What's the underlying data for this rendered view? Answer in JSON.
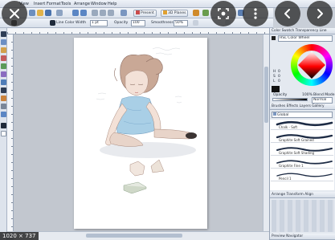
{
  "menu": [
    "View",
    "Insert",
    "Format",
    "Tools",
    "Arrange",
    "Window",
    "Help"
  ],
  "toolbar": {
    "present_label": "Present",
    "planes_label": "3D Planes"
  },
  "properties": {
    "line_color_label": "Line Color",
    "width_label": "Width",
    "width_value": "1 pt",
    "opacity_label": "Opacity",
    "opacity_value": "100",
    "smoothness_label": "Smoothness",
    "smoothness_value": "50%"
  },
  "color_panel": {
    "tabs": "Color  Swatch  Transparency  Line",
    "mode_select": "HSL Color Wheel",
    "h_label": "H",
    "h_value": "0",
    "s_label": "S",
    "s_value": "0",
    "l_label": "L",
    "l_value": "0",
    "opacity_label": "Opacity",
    "opacity_value": "100%",
    "blend_label": "Blend Mode",
    "blend_value": "Normal"
  },
  "brushes_panel": {
    "tabs": "Brushes  Effects  Layers  Gallery",
    "category": "Global",
    "brushes": [
      "Chalk - Soft",
      "Graphite Soft Grained",
      "Graphite Soft Shading",
      "Graphite Fine 1",
      "Pencil 1"
    ]
  },
  "arrange_panel": {
    "tabs": "Arrange  Transform  Align"
  },
  "bottom_tabs": "Preview  Navigator",
  "dimensions_badge": "1020 × 737",
  "colors": {
    "accent": "#3d6fb5",
    "panel_bg": "#e4e9f0",
    "canvas_bg": "#c2c7cf"
  },
  "icons": [
    "close-icon",
    "lens-icon",
    "more-vert-icon",
    "chevron-left-icon",
    "chevron-right-icon"
  ]
}
